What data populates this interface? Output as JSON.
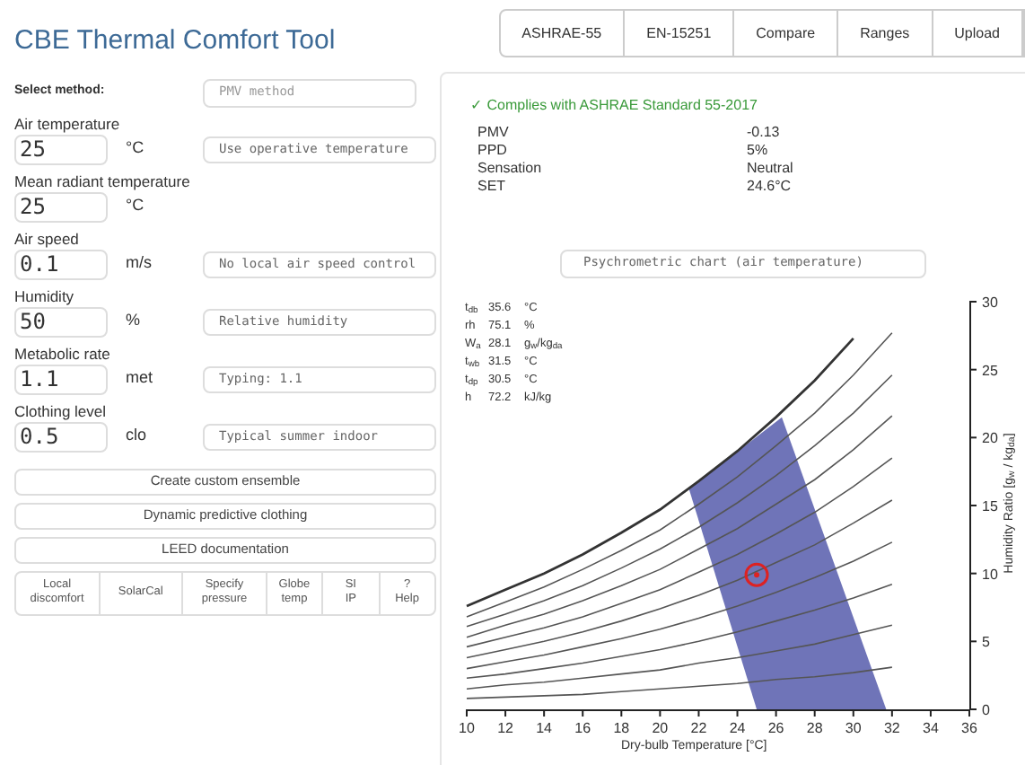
{
  "title": "CBE Thermal Comfort Tool",
  "tabs": [
    {
      "label": "ASHRAE-55"
    },
    {
      "label": "EN-15251"
    },
    {
      "label": "Compare"
    },
    {
      "label": "Ranges"
    },
    {
      "label": "Upload"
    }
  ],
  "method": {
    "label": "Select method:",
    "value": "PMV method"
  },
  "inputs": [
    {
      "label": "Air temperature",
      "value": "25",
      "unit": "°C",
      "option": "Use operative temperature"
    },
    {
      "label": "Mean radiant temperature",
      "value": "25",
      "unit": "°C"
    },
    {
      "label": "Air speed",
      "value": "0.1",
      "unit": "m/s",
      "option": "No local air speed control"
    },
    {
      "label": "Humidity",
      "value": "50",
      "unit": "%",
      "option": "Relative humidity"
    },
    {
      "label": "Metabolic rate",
      "value": "1.1",
      "unit": "met",
      "option": "Typing: 1.1"
    },
    {
      "label": "Clothing level",
      "value": "0.5",
      "unit": "clo",
      "option": "Typical summer indoor"
    }
  ],
  "buttons": [
    "Create custom ensemble",
    "Dynamic predictive clothing",
    "LEED documentation"
  ],
  "bottom_buttons": [
    [
      "Local",
      "discomfort"
    ],
    [
      "SolarCal"
    ],
    [
      "Specify",
      "pressure"
    ],
    [
      "Globe",
      "temp"
    ],
    [
      "SI",
      "IP"
    ],
    [
      "?",
      "Help"
    ]
  ],
  "compliance": "✓ Complies with ASHRAE Standard 55-2017",
  "results": [
    {
      "label": "PMV",
      "value": "-0.13"
    },
    {
      "label": "PPD",
      "value": "5%"
    },
    {
      "label": "Sensation",
      "value": "Neutral"
    },
    {
      "label": "SET",
      "value": "24.6°C"
    }
  ],
  "chart_select": "Psychrometric chart (air temperature)",
  "hover": [
    {
      "label": "t$_{db}$",
      "value": "35.6",
      "unit": "°C"
    },
    {
      "label": "rh",
      "value": "75.1",
      "unit": "%"
    },
    {
      "label": "W$_{a}$",
      "value": "28.1",
      "unit": "g$_{w}$/kg$_{da}$"
    },
    {
      "label": "t$_{wb}$",
      "value": "31.5",
      "unit": "°C"
    },
    {
      "label": "t$_{dp}$",
      "value": "30.5",
      "unit": "°C"
    },
    {
      "label": "h",
      "value": "72.2",
      "unit": "kJ/kg"
    }
  ],
  "chart_data": {
    "type": "line",
    "xlabel": "Dry-bulb Temperature [°C]",
    "ylabel": "Humidity Ratio [g$_{w}$ / kg$_{da}$]",
    "x": [
      10,
      12,
      14,
      16,
      18,
      20,
      22,
      24,
      26,
      28,
      30,
      32
    ],
    "series": [
      {
        "color": "#333333",
        "values": [
          7.6,
          8.8,
          10.0,
          11.4,
          13.0,
          14.7,
          16.8,
          19.0,
          21.5,
          24.2,
          27.3,
          null
        ]
      },
      {
        "color": "#555555",
        "values": [
          6.8,
          7.9,
          9.0,
          10.3,
          11.7,
          13.2,
          15.1,
          17.1,
          19.4,
          21.8,
          24.6,
          27.7
        ]
      },
      {
        "color": "#555555",
        "values": [
          6.1,
          7.0,
          8.0,
          9.1,
          10.4,
          11.8,
          13.4,
          15.2,
          17.2,
          19.4,
          21.8,
          24.6
        ]
      },
      {
        "color": "#555555",
        "values": [
          5.3,
          6.2,
          7.0,
          8.0,
          9.1,
          10.3,
          11.8,
          13.3,
          15.1,
          16.9,
          19.1,
          21.6
        ]
      },
      {
        "color": "#555555",
        "values": [
          4.6,
          5.3,
          6.0,
          6.8,
          7.8,
          8.8,
          10.1,
          11.4,
          12.9,
          14.5,
          16.4,
          18.5
        ]
      },
      {
        "color": "#555555",
        "values": [
          3.8,
          4.4,
          5.0,
          5.7,
          6.5,
          7.4,
          8.4,
          9.5,
          10.8,
          12.1,
          13.7,
          15.4
        ]
      },
      {
        "color": "#555555",
        "values": [
          3.0,
          3.5,
          4.0,
          4.6,
          5.2,
          5.9,
          6.7,
          7.6,
          8.6,
          9.7,
          10.9,
          12.3
        ]
      },
      {
        "color": "#555555",
        "values": [
          2.3,
          2.6,
          3.0,
          3.4,
          3.9,
          4.4,
          5.0,
          5.7,
          6.5,
          7.3,
          8.2,
          9.2
        ]
      },
      {
        "color": "#555555",
        "values": [
          1.5,
          1.8,
          2.0,
          2.3,
          2.6,
          2.9,
          3.4,
          3.8,
          4.3,
          4.8,
          5.5,
          6.2
        ]
      },
      {
        "color": "#555555",
        "values": [
          0.8,
          0.9,
          1.0,
          1.1,
          1.3,
          1.5,
          1.7,
          1.9,
          2.2,
          2.4,
          2.7,
          3.1
        ]
      }
    ],
    "xlim": [
      10,
      36
    ],
    "ylim": [
      0,
      30
    ],
    "xticks": [
      10,
      12,
      14,
      16,
      18,
      20,
      22,
      24,
      26,
      28,
      30,
      32,
      34,
      36
    ],
    "yticks": [
      0,
      5,
      10,
      15,
      20,
      25,
      30
    ]
  }
}
